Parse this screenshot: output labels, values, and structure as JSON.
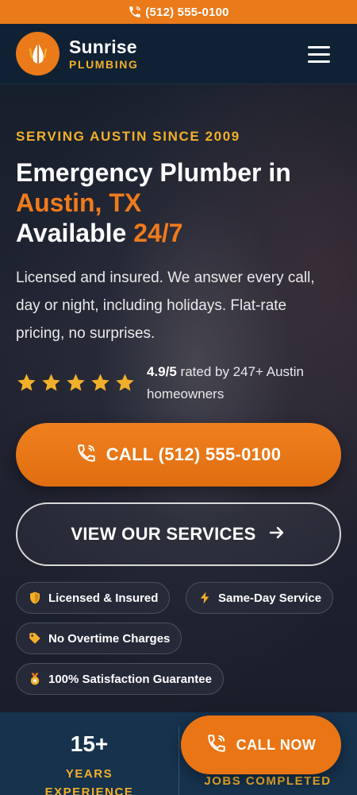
{
  "topbar": {
    "phone": "(512) 555-0100"
  },
  "header": {
    "brand_name": "Sunrise",
    "brand_sub": "PLUMBING"
  },
  "hero": {
    "kicker": "SERVING AUSTIN SINCE 2009",
    "h1_line1": "Emergency Plumber in",
    "h1_city": "Austin, TX",
    "h1_avail": "Available ",
    "h1_247": "24/7",
    "lede": "Licensed and insured. We answer every call, day or night, including holidays. Flat-rate pricing, no surprises.",
    "rating_value": "4.9/5",
    "rating_text": " rated by 247+ Austin homeowners",
    "stars": 5,
    "call_button": "CALL (512) 555-0100",
    "services_button": "VIEW OUR SERVICES"
  },
  "badges": [
    {
      "label": "Licensed & Insured",
      "icon": "shield-icon"
    },
    {
      "label": "Same-Day Service",
      "icon": "bolt-icon"
    },
    {
      "label": "No Overtime Charges",
      "icon": "tag-icon"
    },
    {
      "label": "100% Satisfaction Guarantee",
      "icon": "medal-icon"
    }
  ],
  "stats": {
    "years_num": "15+",
    "years_label_1": "YEARS",
    "years_label_2": "EXPERIENCE",
    "jobs_label": "JOBS COMPLETED"
  },
  "fab": {
    "label": "CALL NOW"
  },
  "colors": {
    "accent": "#ea7a1a",
    "gold": "#f2b02a",
    "navy": "#0f2133"
  }
}
